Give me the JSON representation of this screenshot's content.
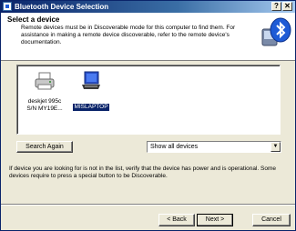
{
  "window": {
    "title": "Bluetooth Device Selection"
  },
  "header": {
    "title": "Select a device",
    "description": "Remote devices must be in Discoverable mode for this computer to find them. For assistance in making a remote device discoverable, refer to the remote device's documentation."
  },
  "devices": [
    {
      "label": "deskjet 995c\nS/N MY19E...",
      "icon": "printer-icon",
      "selected": false
    },
    {
      "label": "MISLAPTOP",
      "icon": "laptop-icon",
      "selected": true
    }
  ],
  "search_button": "Search Again",
  "filter": {
    "selected": "Show all devices"
  },
  "info_text": "If device you are looking for is not in the list, verify that the device has power and is operational. Some devices require to press a special button to be Discoverable.",
  "buttons": {
    "back": "< Back",
    "next": "Next >",
    "cancel": "Cancel"
  }
}
